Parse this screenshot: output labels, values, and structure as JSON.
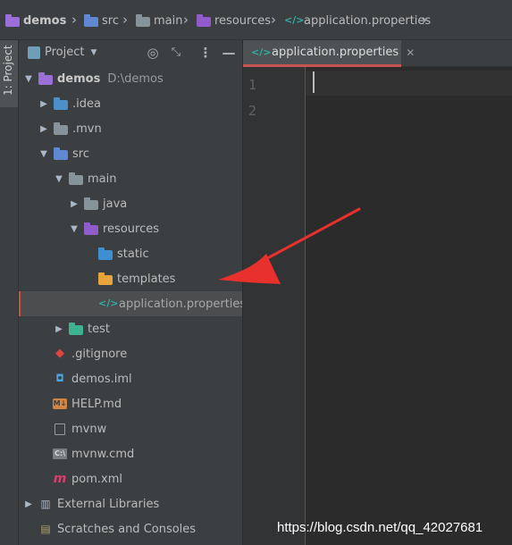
{
  "breadcrumb": {
    "items": [
      {
        "label": "demos",
        "icon": "module-folder-icon"
      },
      {
        "label": "src",
        "icon": "source-folder-icon"
      },
      {
        "label": "main",
        "icon": "folder-icon"
      },
      {
        "label": "resources",
        "icon": "resources-folder-icon"
      },
      {
        "label": "application.properties",
        "icon": "properties-file-icon"
      }
    ]
  },
  "tool_strip": {
    "tab_label": "1: Project"
  },
  "project_panel": {
    "view_label": "Project",
    "tree": {
      "root_label": "demos",
      "root_path": "D:\\demos",
      "items": [
        "demos",
        ".idea",
        ".mvn",
        "src",
        "main",
        "java",
        "resources",
        "static",
        "templates",
        "application.properties",
        "test",
        ".gitignore",
        "demos.iml",
        "HELP.md",
        "mvnw",
        "mvnw.cmd",
        "pom.xml",
        "External Libraries",
        "Scratches and Consoles"
      ],
      "selected": "application.properties"
    }
  },
  "editor": {
    "tab_label": "application.properties",
    "line_numbers": [
      "1",
      "2"
    ]
  },
  "watermark": "https://blog.csdn.net/qq_42027681",
  "colors": {
    "accent": "#c75450",
    "annotation_arrow": "#e8302c",
    "module_folder": "#9b6fd8",
    "source_folder": "#5f88d1",
    "resources_folder": "#8f5cc9",
    "test_folder": "#3fb28f",
    "properties_icon": "#2fb0a5"
  }
}
